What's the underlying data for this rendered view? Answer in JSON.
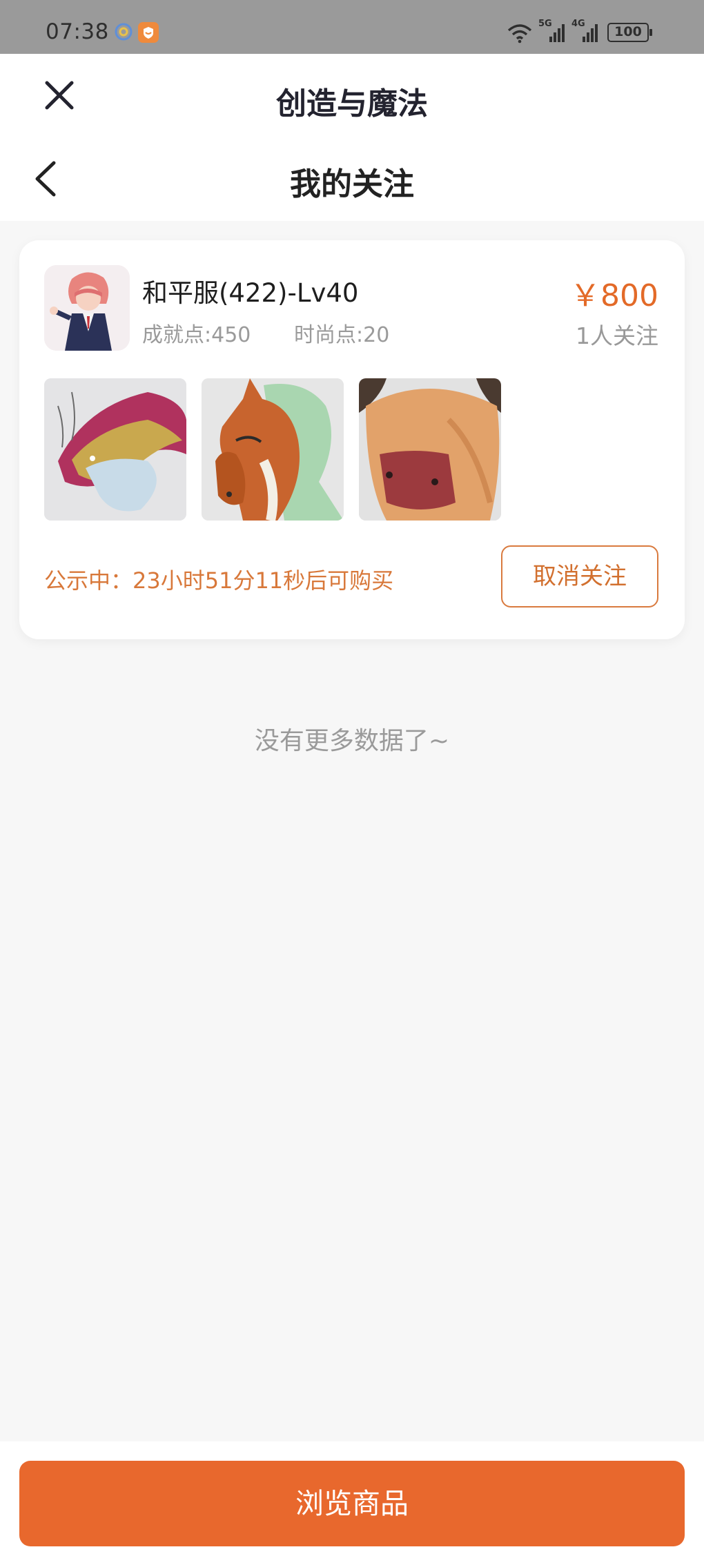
{
  "status_bar": {
    "time": "07:38",
    "signal_5g_label": "5G",
    "signal_4g_label": "4G",
    "battery": "100",
    "icons": [
      "assistant-icon",
      "app-shield-icon",
      "wifi-icon",
      "signal-5g-icon",
      "signal-4g-icon",
      "battery-icon"
    ]
  },
  "header": {
    "title": "创造与魔法",
    "close_icon": "close-icon"
  },
  "nav": {
    "title": "我的关注",
    "back_icon": "chevron-left-icon"
  },
  "listing": {
    "name": "和平服(422)-Lv40",
    "achievement": "成就点:450",
    "fashion": "时尚点:20",
    "price": "￥800",
    "followers": "1人关注",
    "thumbnails": [
      "dragon-mount-image",
      "horse-mount-image",
      "yak-mount-image"
    ],
    "notice": "公示中：23小时51分11秒后可购买",
    "unfollow_label": "取消关注"
  },
  "no_more_text": "没有更多数据了~",
  "bottom": {
    "browse_label": "浏览商品"
  },
  "colors": {
    "accent": "#e8682d",
    "price": "#e36a28",
    "notice": "#d8783a",
    "statusbar": "#9a9a9a",
    "page_bg": "#f7f7f7"
  }
}
